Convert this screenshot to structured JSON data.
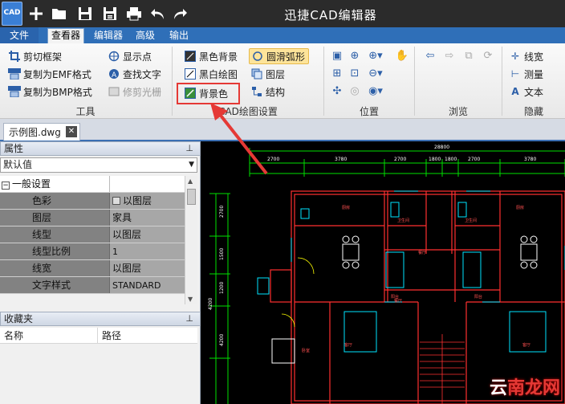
{
  "title": "迅捷CAD编辑器",
  "logo_text": "CAD",
  "colors": {
    "titlebar": "#2b2b2b",
    "accent": "#2f6fb8",
    "highlight": "#e53935",
    "cad_lines": "#ff3030",
    "cad_dims": "#00e000",
    "cad_fixtures": "#00e5ff"
  },
  "quick_access": [
    "new-icon",
    "open-icon",
    "save-icon",
    "save-as-icon",
    "print-icon",
    "undo-icon",
    "redo-icon"
  ],
  "tabs": [
    {
      "label": "文件"
    },
    {
      "label": "查看器"
    },
    {
      "label": "编辑器"
    },
    {
      "label": "高级"
    },
    {
      "label": "输出"
    }
  ],
  "ribbon": {
    "tools": {
      "label": "工具",
      "buttons": [
        "剪切框架",
        "复制为EMF格式",
        "复制为BMP格式",
        "显示点",
        "查找文字",
        "修剪光栅"
      ]
    },
    "cad_settings": {
      "label": "CAD绘图设置",
      "buttons": [
        "黑色背景",
        "黑白绘图",
        "背景色",
        "圆滑弧形",
        "图层",
        "结构"
      ]
    },
    "position": {
      "label": "位置"
    },
    "browse": {
      "label": "浏览"
    },
    "hide": {
      "label": "隐藏",
      "buttons": [
        "线宽",
        "测量",
        "文本"
      ]
    }
  },
  "document_tab": "示例图.dwg",
  "properties": {
    "header": "属性",
    "combo": "默认值",
    "category": "一般设置",
    "rows": [
      {
        "k": "色彩",
        "v": "以图层"
      },
      {
        "k": "图层",
        "v": "家具"
      },
      {
        "k": "线型",
        "v": "以图层"
      },
      {
        "k": "线型比例",
        "v": "1"
      },
      {
        "k": "线宽",
        "v": "以图层"
      },
      {
        "k": "文字样式",
        "v": "STANDARD"
      }
    ]
  },
  "favorites": {
    "header": "收藏夹",
    "col_name": "名称",
    "col_path": "路径"
  },
  "drawing": {
    "total_dim": "28800",
    "dims_top": [
      "2700",
      "3780",
      "2700",
      "1800",
      "1800",
      "2700",
      "3780",
      "2700"
    ],
    "dims_left": [
      "2700",
      "1500",
      "1200",
      "4200",
      "4200"
    ],
    "room_labels": [
      "厨房",
      "厨房",
      "餐厅",
      "餐厅",
      "卧室",
      "卧室",
      "客厅",
      "客厅",
      "卫生间",
      "卫生间",
      "阳台",
      "阳台",
      "卧室",
      "卧室"
    ]
  },
  "watermark": {
    "a": "云",
    "b": "南龙网"
  }
}
